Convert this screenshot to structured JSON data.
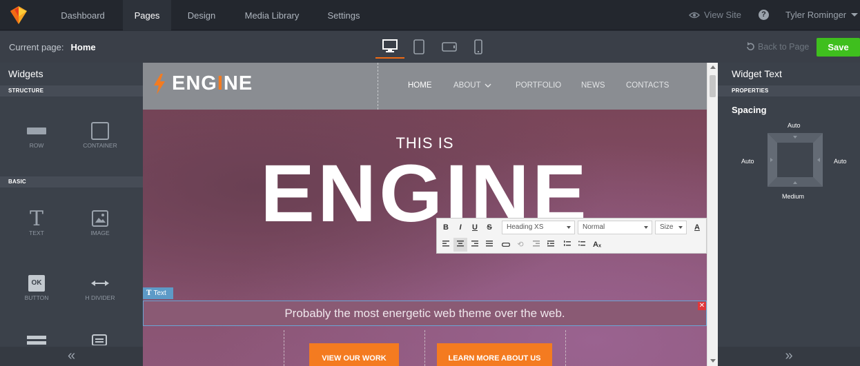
{
  "nav": {
    "items": [
      "Dashboard",
      "Pages",
      "Design",
      "Media Library",
      "Settings"
    ],
    "active": "Pages",
    "view_site": "View Site",
    "user_name": "Tyler Rominger",
    "help_glyph": "?"
  },
  "toolbar": {
    "current_page_label": "Current page:",
    "current_page_value": "Home",
    "back_to_page": "Back to Page",
    "save_label": "Save",
    "devices": [
      "desktop-icon",
      "tablet-icon",
      "tablet-landscape-icon",
      "phone-icon"
    ],
    "active_device": "desktop-icon"
  },
  "left_panel": {
    "title": "Widgets",
    "sections": [
      {
        "name": "STRUCTURE",
        "widgets": [
          "ROW",
          "CONTAINER"
        ]
      },
      {
        "name": "BASIC",
        "widgets": [
          "TEXT",
          "IMAGE",
          "BUTTON",
          "H DIVIDER"
        ]
      }
    ],
    "button_widget_glyph": "OK",
    "collapse_glyph": "«"
  },
  "right_panel": {
    "title": "Widget Text",
    "section": "PROPERTIES",
    "spacing_title": "Spacing",
    "spacing": {
      "top": "Auto",
      "left": "Auto",
      "right": "Auto",
      "bottom": "Medium"
    },
    "expand_glyph": "»"
  },
  "site": {
    "brand_pre": "ENG",
    "brand_accent": "I",
    "brand_post": "NE",
    "menu": [
      "HOME",
      "ABOUT",
      "PORTFOLIO",
      "NEWS",
      "CONTACTS"
    ],
    "hero_pre": "THIS IS",
    "hero_title": "ENGINE",
    "text_tag": "Text",
    "tagline": "Probably the most energetic web theme over the web.",
    "cta_primary": "VIEW OUR WORK",
    "cta_secondary": "LEARN MORE ABOUT US"
  },
  "rte": {
    "bold": "B",
    "italic": "I",
    "underline": "U",
    "strike": "S",
    "style_select": "Heading XS",
    "format_select": "Normal",
    "size_select": "Size",
    "color_glyph": "A",
    "clear_format": "Aₓ"
  },
  "colors": {
    "accent": "#f47b20",
    "save": "#3fbf1e",
    "close": "#e0383b",
    "selection": "#6aa6d6"
  }
}
